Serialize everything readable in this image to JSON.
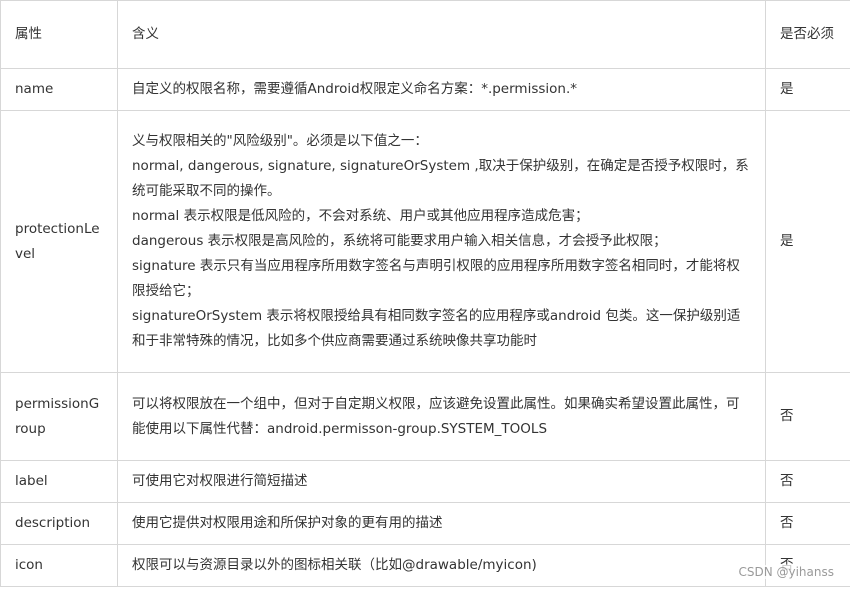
{
  "header": {
    "attr": "属性",
    "meaning": "含义",
    "required": "是否必须"
  },
  "rows": [
    {
      "attr": "name",
      "desc": [
        "自定义的权限名称，需要遵循Android权限定义命名方案：*.permission.*"
      ],
      "required": "是"
    },
    {
      "attr": "protectionLevel",
      "desc": [
        "义与权限相关的\"风险级别\"。必须是以下值之一：",
        "normal, dangerous, signature, signatureOrSystem ,取决于保护级别，在确定是否授予权限时，系统可能采取不同的操作。",
        "normal 表示权限是低风险的，不会对系统、用户或其他应用程序造成危害；",
        "dangerous 表示权限是高风险的，系统将可能要求用户输入相关信息，才会授予此权限；",
        "signature 表示只有当应用程序所用数字签名与声明引权限的应用程序所用数字签名相同时，才能将权限授给它；",
        "signatureOrSystem 表示将权限授给具有相同数字签名的应用程序或android 包类。这一保护级别适和于非常特殊的情况，比如多个供应商需要通过系统映像共享功能时"
      ],
      "required": "是"
    },
    {
      "attr": "permissionGroup",
      "desc": [
        "可以将权限放在一个组中，但对于自定期义权限，应该避免设置此属性。如果确实希望设置此属性，可能使用以下属性代替：android.permisson-group.SYSTEM_TOOLS"
      ],
      "required": "否"
    },
    {
      "attr": "label",
      "desc": [
        "可使用它对权限进行简短描述"
      ],
      "required": "否"
    },
    {
      "attr": "description",
      "desc": [
        "使用它提供对权限用途和所保护对象的更有用的描述"
      ],
      "required": "否"
    },
    {
      "attr": "icon",
      "desc": [
        "权限可以与资源目录以外的图标相关联（比如@drawable/myicon)"
      ],
      "required": "否"
    }
  ],
  "watermark": "CSDN @yihanss"
}
